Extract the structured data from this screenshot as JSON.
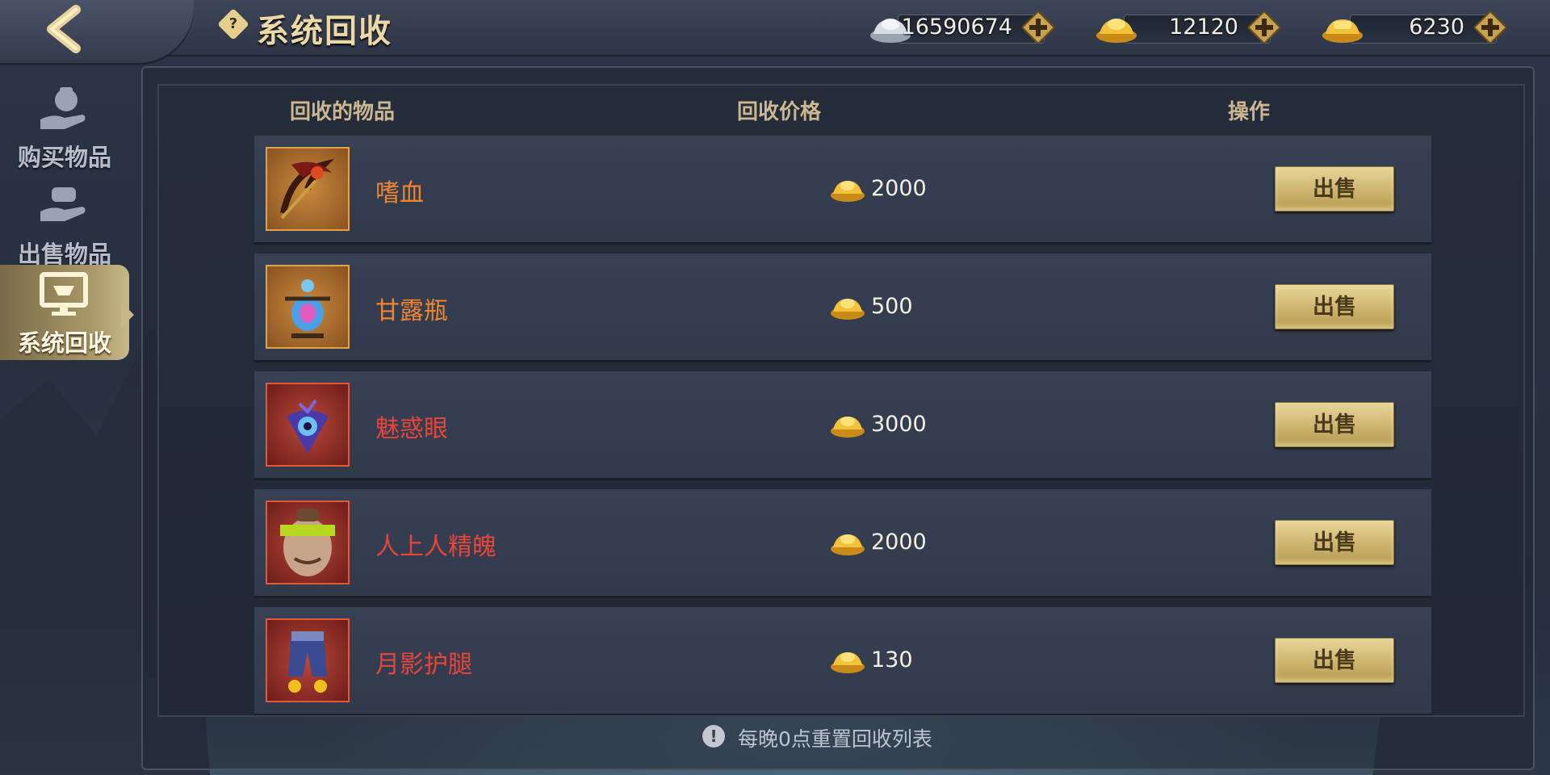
{
  "header": {
    "title": "系统回收",
    "currencies": [
      {
        "name": "silver-ingot",
        "value": "16590674"
      },
      {
        "name": "gold-ingot",
        "value": "12120"
      },
      {
        "name": "bound-gold-ingot",
        "value": "6230"
      }
    ]
  },
  "sidebar": {
    "items": [
      {
        "label": "购买物品",
        "icon": "money-bag-hand-icon"
      },
      {
        "label": "出售物品",
        "icon": "hand-give-icon"
      },
      {
        "label": "系统回收",
        "icon": "monitor-icon",
        "active": true
      }
    ]
  },
  "table": {
    "headers": [
      "回收的物品",
      "回收价格",
      "操作"
    ],
    "rows": [
      {
        "name": "嗜血",
        "price": "2000",
        "rarity": "orange",
        "button": "出售"
      },
      {
        "name": "甘露瓶",
        "price": "500",
        "rarity": "orange",
        "button": "出售"
      },
      {
        "name": "魅惑眼",
        "price": "3000",
        "rarity": "red",
        "button": "出售"
      },
      {
        "name": "人上人精魄",
        "price": "2000",
        "rarity": "red",
        "button": "出售"
      },
      {
        "name": "月影护腿",
        "price": "130",
        "rarity": "red",
        "button": "出售"
      }
    ]
  },
  "footer": {
    "note": "每晚0点重置回收列表"
  },
  "colors": {
    "orange_item": "#f0852e",
    "red_item": "#e8443a",
    "gold_button": "#cdb46e"
  }
}
